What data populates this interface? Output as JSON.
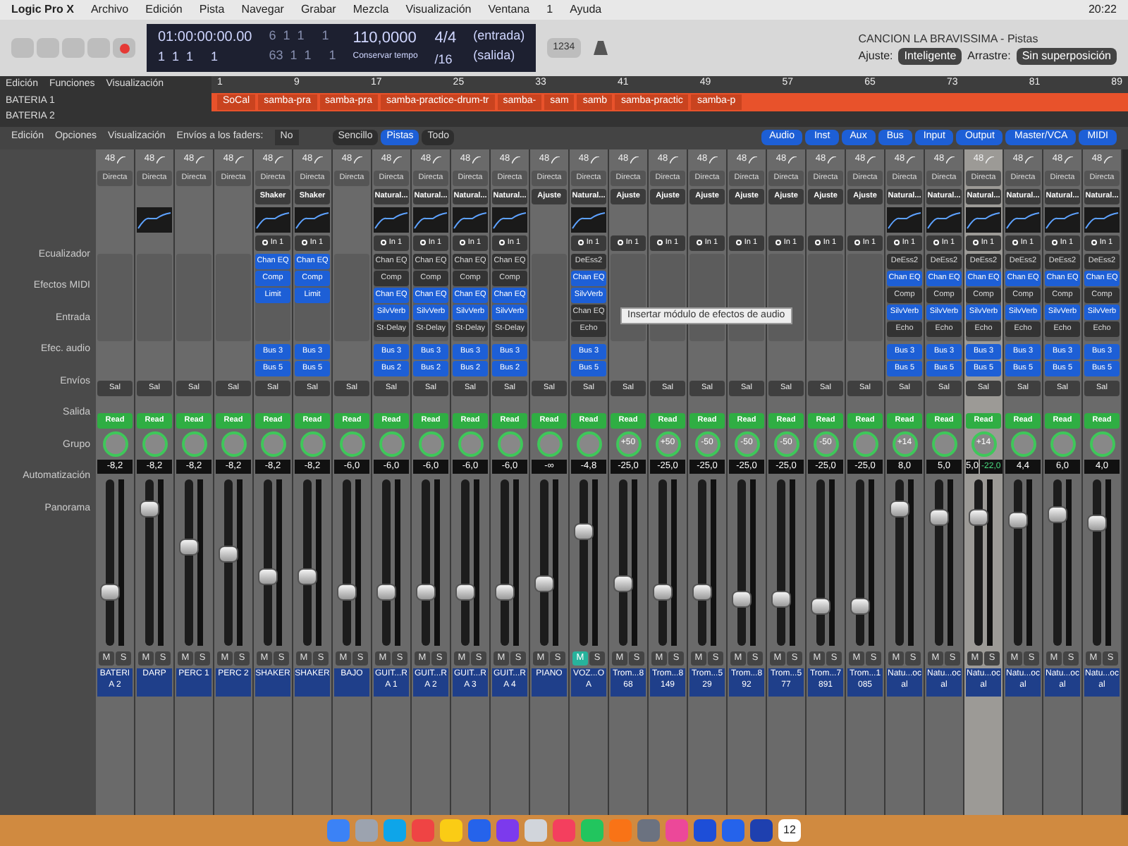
{
  "menu_bar": {
    "items": [
      "Logic Pro X",
      "Archivo",
      "Edición",
      "Pista",
      "Navegar",
      "Grabar",
      "Mezcla",
      "Visualización",
      "Ventana",
      "1",
      "Ayuda"
    ],
    "clock": "20:22"
  },
  "window": {
    "title": "CANCION LA BRAVISSIMA - Pistas"
  },
  "lcd": {
    "time": "01:00:00:00.00",
    "bars": "1  1  1     1",
    "position": "6  1  1     1",
    "length": "63  1  1     1",
    "tempo": "110,0000",
    "tempo_label": "Conservar tempo",
    "signature": "4/4",
    "division": "/16",
    "input": "(entrada)",
    "output": "(salida)"
  },
  "toolbar": {
    "counter": "1234",
    "snap_label": "Ajuste:",
    "snap": "Inteligente",
    "drag_label": "Arrastre:",
    "drag": "Sin superposición"
  },
  "tracks_menu": [
    "Edición",
    "Funciones",
    "Visualización"
  ],
  "ruler": {
    "ticks": [
      "1",
      "9",
      "17",
      "25",
      "33",
      "41",
      "49",
      "57",
      "65",
      "73",
      "81",
      "89"
    ]
  },
  "regions": [
    {
      "label": "SoCal"
    },
    {
      "label": "samba-pra"
    },
    {
      "label": "samba-pra"
    },
    {
      "label": "samba-practice-drum-tr"
    },
    {
      "label": "samba-"
    },
    {
      "label": "sam"
    },
    {
      "label": "samb"
    },
    {
      "label": "samba-practic"
    },
    {
      "label": "samba-p"
    }
  ],
  "track_list": [
    {
      "name": "BATERIA 1"
    },
    {
      "name": "BATERIA 2"
    }
  ],
  "mixer_menu": {
    "items": [
      "Edición",
      "Opciones",
      "Visualización"
    ],
    "sends_label": "Envíos a los faders:",
    "sends_value": "No"
  },
  "view_tabs": [
    {
      "label": "Sencillo",
      "selected": false
    },
    {
      "label": "Pistas",
      "selected": true
    },
    {
      "label": "Todo",
      "selected": false
    }
  ],
  "filters": [
    {
      "label": "Audio",
      "selected": true
    },
    {
      "label": "Inst",
      "selected": true
    },
    {
      "label": "Aux",
      "selected": true
    },
    {
      "label": "Bus",
      "selected": true
    },
    {
      "label": "Input",
      "selected": true
    },
    {
      "label": "Output",
      "selected": true
    },
    {
      "label": "Master/VCA",
      "selected": true
    },
    {
      "label": "MIDI",
      "selected": true
    }
  ],
  "row_labels": [
    "Ecualizador",
    "Efectos MIDI",
    "Entrada",
    "Efec. audio",
    "Envíos",
    "Salida",
    "Grupo",
    "Automatización",
    "Panorama"
  ],
  "tooltip": "Insertar módulo de efectos de audio",
  "channels": [
    {
      "name": "BATERIA 2",
      "format": "48",
      "setting": "Directa",
      "eq": false,
      "output": "Sal",
      "automation": "Read",
      "volume": "-8,2",
      "level": 0.3,
      "mute_label": "M",
      "solo_label": "S",
      "muted": false,
      "selected": false
    },
    {
      "name": "DARP",
      "format": "48",
      "setting": "Directa",
      "eq": true,
      "output": "Sal",
      "automation": "Read",
      "volume": "-8,2",
      "level": 0.85,
      "mute_label": "M",
      "solo_label": "S",
      "muted": false,
      "selected": false
    },
    {
      "name": "PERC 1",
      "format": "48",
      "setting": "Directa",
      "eq": false,
      "output": "Sal",
      "automation": "Read",
      "volume": "-8,2",
      "level": 0.6,
      "mute_label": "M",
      "solo_label": "S",
      "muted": false,
      "selected": false
    },
    {
      "name": "PERC 2",
      "format": "48",
      "setting": "Directa",
      "eq": false,
      "output": "Sal",
      "automation": "Read",
      "volume": "-8,2",
      "level": 0.55,
      "mute_label": "M",
      "solo_label": "S",
      "muted": false,
      "selected": false
    },
    {
      "name": "SHAKER",
      "format": "48",
      "setting": "Directa",
      "preset": "Shaker",
      "eq": true,
      "input": "In 1",
      "plugins": [
        {
          "name": "Chan EQ",
          "active": true
        },
        {
          "name": "Comp",
          "active": true
        },
        {
          "name": "Limit",
          "active": true
        }
      ],
      "sends": [
        "Bus 3",
        "Bus 5"
      ],
      "output": "Sal",
      "automation": "Read",
      "volume": "-8,2",
      "level": 0.4,
      "mute_label": "M",
      "solo_label": "S",
      "muted": false,
      "selected": false
    },
    {
      "name": "SHAKER",
      "format": "48",
      "setting": "Directa",
      "preset": "Shaker",
      "eq": true,
      "input": "In 1",
      "plugins": [
        {
          "name": "Chan EQ",
          "active": true
        },
        {
          "name": "Comp",
          "active": true
        },
        {
          "name": "Limit",
          "active": true
        }
      ],
      "sends": [
        "Bus 3",
        "Bus 5"
      ],
      "output": "Sal",
      "automation": "Read",
      "volume": "-8,2",
      "level": 0.4,
      "mute_label": "M",
      "solo_label": "S",
      "muted": false,
      "selected": false
    },
    {
      "name": "BAJO",
      "format": "48",
      "setting": "Directa",
      "eq": false,
      "output": "Sal",
      "automation": "Read",
      "volume": "-6,0",
      "level": 0.3,
      "mute_label": "M",
      "solo_label": "S",
      "muted": false,
      "selected": false
    },
    {
      "name": "GUIT...RA 1",
      "format": "48",
      "setting": "Directa",
      "preset": "Natural...",
      "eq": true,
      "input": "In 1",
      "plugins": [
        {
          "name": "Chan EQ",
          "active": false
        },
        {
          "name": "Comp",
          "active": false
        },
        {
          "name": "Chan EQ",
          "active": true
        },
        {
          "name": "SilvVerb",
          "active": true
        },
        {
          "name": "St-Delay",
          "active": false
        }
      ],
      "sends": [
        "Bus 3",
        "Bus 2"
      ],
      "output": "Sal",
      "automation": "Read",
      "volume": "-6,0",
      "level": 0.3,
      "mute_label": "M",
      "solo_label": "S",
      "muted": false,
      "selected": false
    },
    {
      "name": "GUIT...RA 2",
      "format": "48",
      "setting": "Directa",
      "preset": "Natural...",
      "eq": true,
      "input": "In 1",
      "plugins": [
        {
          "name": "Chan EQ",
          "active": false
        },
        {
          "name": "Comp",
          "active": false
        },
        {
          "name": "Chan EQ",
          "active": true
        },
        {
          "name": "SilvVerb",
          "active": true
        },
        {
          "name": "St-Delay",
          "active": false
        }
      ],
      "sends": [
        "Bus 3",
        "Bus 2"
      ],
      "output": "Sal",
      "automation": "Read",
      "volume": "-6,0",
      "level": 0.3,
      "mute_label": "M",
      "solo_label": "S",
      "muted": false,
      "selected": false
    },
    {
      "name": "GUIT...RA 3",
      "format": "48",
      "setting": "Directa",
      "preset": "Natural...",
      "eq": true,
      "input": "In 1",
      "plugins": [
        {
          "name": "Chan EQ",
          "active": false
        },
        {
          "name": "Comp",
          "active": false
        },
        {
          "name": "Chan EQ",
          "active": true
        },
        {
          "name": "SilvVerb",
          "active": true
        },
        {
          "name": "St-Delay",
          "active": false
        }
      ],
      "sends": [
        "Bus 3",
        "Bus 2"
      ],
      "output": "Sal",
      "automation": "Read",
      "volume": "-6,0",
      "level": 0.3,
      "mute_label": "M",
      "solo_label": "S",
      "muted": false,
      "selected": false
    },
    {
      "name": "GUIT...RA 4",
      "format": "48",
      "setting": "Directa",
      "preset": "Natural...",
      "eq": true,
      "input": "In 1",
      "plugins": [
        {
          "name": "Chan EQ",
          "active": false
        },
        {
          "name": "Comp",
          "active": false
        },
        {
          "name": "Chan EQ",
          "active": true
        },
        {
          "name": "SilvVerb",
          "active": true
        },
        {
          "name": "St-Delay",
          "active": false
        }
      ],
      "sends": [
        "Bus 3",
        "Bus 2"
      ],
      "output": "Sal",
      "automation": "Read",
      "volume": "-6,0",
      "level": 0.3,
      "mute_label": "M",
      "solo_label": "S",
      "muted": false,
      "selected": false
    },
    {
      "name": "PIANO",
      "format": "48",
      "setting": "Directa",
      "preset": "Ajuste",
      "eq": false,
      "output": "Sal",
      "automation": "Read",
      "volume": "-∞",
      "level": 0.35,
      "mute_label": "M",
      "solo_label": "S",
      "muted": false,
      "selected": false
    },
    {
      "name": "VOZ...OA",
      "format": "48",
      "setting": "Directa",
      "preset": "Natural...",
      "eq": true,
      "input": "In 1",
      "plugins": [
        {
          "name": "DeEss2",
          "active": false
        },
        {
          "name": "Chan EQ",
          "active": true
        },
        {
          "name": "SilvVerb",
          "active": true
        },
        {
          "name": "Chan EQ",
          "active": false
        },
        {
          "name": "Echo",
          "active": false
        }
      ],
      "sends": [
        "Bus 3",
        "Bus 5"
      ],
      "output": "Sal",
      "automation": "Read",
      "volume": "-4,8",
      "level": 0.7,
      "mute_label": "M",
      "solo_label": "S",
      "muted": true,
      "selected": false
    },
    {
      "name": "Trom...868",
      "format": "48",
      "setting": "Directa",
      "preset": "Ajuste",
      "eq": false,
      "input": "In 1",
      "output": "Sal",
      "automation": "Read",
      "pan": "+50",
      "volume": "-25,0",
      "level": 0.35,
      "mute_label": "M",
      "solo_label": "S",
      "muted": false,
      "selected": false
    },
    {
      "name": "Trom...8149",
      "format": "48",
      "setting": "Directa",
      "preset": "Ajuste",
      "eq": false,
      "input": "In 1",
      "output": "Sal",
      "automation": "Read",
      "pan": "+50",
      "volume": "-25,0",
      "level": 0.3,
      "mute_label": "M",
      "solo_label": "S",
      "muted": false,
      "selected": false
    },
    {
      "name": "Trom...529",
      "format": "48",
      "setting": "Directa",
      "preset": "Ajuste",
      "eq": false,
      "input": "In 1",
      "output": "Sal",
      "automation": "Read",
      "pan": "-50",
      "volume": "-25,0",
      "level": 0.3,
      "mute_label": "M",
      "solo_label": "S",
      "muted": false,
      "selected": false
    },
    {
      "name": "Trom...892",
      "format": "48",
      "setting": "Directa",
      "preset": "Ajuste",
      "eq": false,
      "input": "In 1",
      "output": "Sal",
      "automation": "Read",
      "pan": "-50",
      "volume": "-25,0",
      "level": 0.25,
      "mute_label": "M",
      "solo_label": "S",
      "muted": false,
      "selected": false
    },
    {
      "name": "Trom...577",
      "format": "48",
      "setting": "Directa",
      "preset": "Ajuste",
      "eq": false,
      "input": "In 1",
      "output": "Sal",
      "automation": "Read",
      "pan": "-50",
      "volume": "-25,0",
      "level": 0.25,
      "mute_label": "M",
      "solo_label": "S",
      "muted": false,
      "selected": false
    },
    {
      "name": "Trom...7891",
      "format": "48",
      "setting": "Directa",
      "preset": "Ajuste",
      "eq": false,
      "input": "In 1",
      "output": "Sal",
      "automation": "Read",
      "pan": "-50",
      "volume": "-25,0",
      "level": 0.2,
      "mute_label": "M",
      "solo_label": "S",
      "muted": false,
      "selected": false
    },
    {
      "name": "Trom...1085",
      "format": "48",
      "setting": "Directa",
      "preset": "Ajuste",
      "eq": false,
      "input": "In 1",
      "output": "Sal",
      "automation": "Read",
      "volume": "-25,0",
      "level": 0.2,
      "mute_label": "M",
      "solo_label": "S",
      "muted": false,
      "selected": false
    },
    {
      "name": "Natu...ocal",
      "format": "48",
      "setting": "Directa",
      "preset": "Natural...",
      "eq": true,
      "input": "In 1",
      "plugins": [
        {
          "name": "DeEss2",
          "active": false
        },
        {
          "name": "Chan EQ",
          "active": true
        },
        {
          "name": "Comp",
          "active": false
        },
        {
          "name": "SilvVerb",
          "active": true
        },
        {
          "name": "Echo",
          "active": false
        }
      ],
      "sends": [
        "Bus 3",
        "Bus 5"
      ],
      "output": "Sal",
      "automation": "Read",
      "pan": "+14",
      "volume": "8,0",
      "level": 0.85,
      "mute_label": "M",
      "solo_label": "S",
      "muted": false,
      "selected": false
    },
    {
      "name": "Natu...ocal",
      "format": "48",
      "setting": "Directa",
      "preset": "Natural...",
      "eq": true,
      "input": "In 1",
      "plugins": [
        {
          "name": "DeEss2",
          "active": false
        },
        {
          "name": "Chan EQ",
          "active": true
        },
        {
          "name": "Comp",
          "active": false
        },
        {
          "name": "SilvVerb",
          "active": true
        },
        {
          "name": "Echo",
          "active": false
        }
      ],
      "sends": [
        "Bus 3",
        "Bus 5"
      ],
      "output": "Sal",
      "automation": "Read",
      "volume": "5,0",
      "level": 0.8,
      "mute_label": "M",
      "solo_label": "S",
      "muted": false,
      "selected": false
    },
    {
      "name": "Natu...ocal",
      "format": "48",
      "setting": "Directa",
      "preset": "Natural...",
      "eq": true,
      "input": "In 1",
      "plugins": [
        {
          "name": "DeEss2",
          "active": false
        },
        {
          "name": "Chan EQ",
          "active": true
        },
        {
          "name": "Comp",
          "active": false
        },
        {
          "name": "SilvVerb",
          "active": true
        },
        {
          "name": "Echo",
          "active": false
        }
      ],
      "sends": [
        "Bus 3",
        "Bus 5"
      ],
      "output": "Sal",
      "automation": "Read",
      "pan": "+14",
      "volume": "5,0",
      "peak": "-22,0",
      "level": 0.8,
      "mute_label": "M",
      "solo_label": "S",
      "muted": false,
      "selected": true
    },
    {
      "name": "Natu...ocal",
      "format": "48",
      "setting": "Directa",
      "preset": "Natural...",
      "eq": true,
      "input": "In 1",
      "plugins": [
        {
          "name": "DeEss2",
          "active": false
        },
        {
          "name": "Chan EQ",
          "active": true
        },
        {
          "name": "Comp",
          "active": false
        },
        {
          "name": "SilvVerb",
          "active": true
        },
        {
          "name": "Echo",
          "active": false
        }
      ],
      "sends": [
        "Bus 3",
        "Bus 5"
      ],
      "output": "Sal",
      "automation": "Read",
      "volume": "4,4",
      "level": 0.78,
      "mute_label": "M",
      "solo_label": "S",
      "muted": false,
      "selected": false
    },
    {
      "name": "Natu...ocal",
      "format": "48",
      "setting": "Directa",
      "preset": "Natural...",
      "eq": true,
      "input": "In 1",
      "plugins": [
        {
          "name": "DeEss2",
          "active": false
        },
        {
          "name": "Chan EQ",
          "active": true
        },
        {
          "name": "Comp",
          "active": false
        },
        {
          "name": "SilvVerb",
          "active": true
        },
        {
          "name": "Echo",
          "active": false
        }
      ],
      "sends": [
        "Bus 3",
        "Bus 5"
      ],
      "output": "Sal",
      "automation": "Read",
      "volume": "6,0",
      "level": 0.82,
      "mute_label": "M",
      "solo_label": "S",
      "muted": false,
      "selected": false
    },
    {
      "name": "Natu...ocal",
      "format": "48",
      "setting": "Directa",
      "preset": "Natural...",
      "eq": true,
      "input": "In 1",
      "plugins": [
        {
          "name": "DeEss2",
          "active": false
        },
        {
          "name": "Chan EQ",
          "active": true
        },
        {
          "name": "Comp",
          "active": false
        },
        {
          "name": "SilvVerb",
          "active": true
        },
        {
          "name": "Echo",
          "active": false
        }
      ],
      "sends": [
        "Bus 3",
        "Bus 5"
      ],
      "output": "Sal",
      "automation": "Read",
      "volume": "4,0",
      "level": 0.76,
      "mute_label": "M",
      "solo_label": "S",
      "muted": false,
      "selected": false
    }
  ],
  "dock": {
    "calendar_day": "12"
  }
}
